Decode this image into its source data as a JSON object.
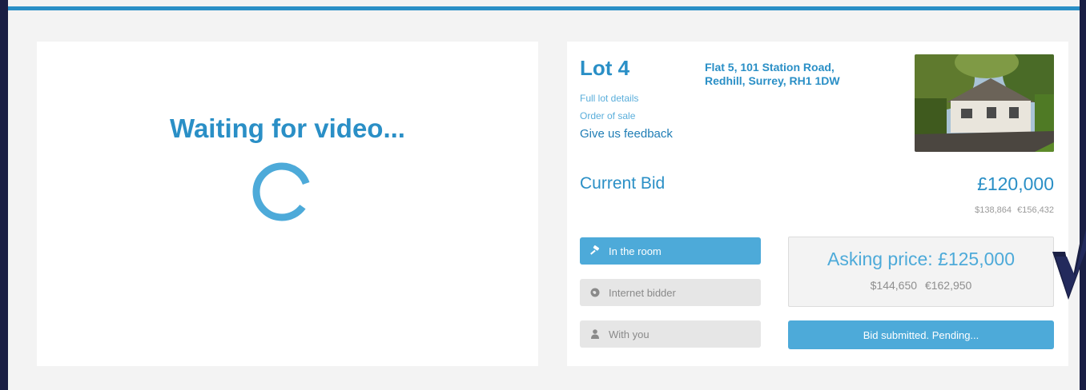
{
  "video": {
    "status": "Waiting for video..."
  },
  "lot": {
    "title": "Lot 4",
    "address_line1": "Flat 5, 101 Station Road,",
    "address_line2": "Redhill, Surrey, RH1 1DW",
    "links": {
      "full_details": "Full lot details",
      "order_of_sale": "Order of sale",
      "feedback": "Give us feedback"
    },
    "photo_icon": "property-photo"
  },
  "current_bid": {
    "label": "Current Bid",
    "value": "£120,000",
    "alt_usd": "$138,864",
    "alt_eur": "€156,432"
  },
  "bidders": [
    {
      "label": "In the room",
      "icon": "gavel-icon",
      "active": true
    },
    {
      "label": "Internet bidder",
      "icon": "globe-icon",
      "active": false
    },
    {
      "label": "With you",
      "icon": "user-icon",
      "active": false
    }
  ],
  "asking": {
    "label": "Asking price: £125,000",
    "alt_usd": "$144,650",
    "alt_eur": "€162,950"
  },
  "submit": {
    "label": "Bid submitted. Pending..."
  },
  "colors": {
    "accent": "#2a8fc6",
    "button": "#4daad9",
    "border": "#1a1f44"
  }
}
